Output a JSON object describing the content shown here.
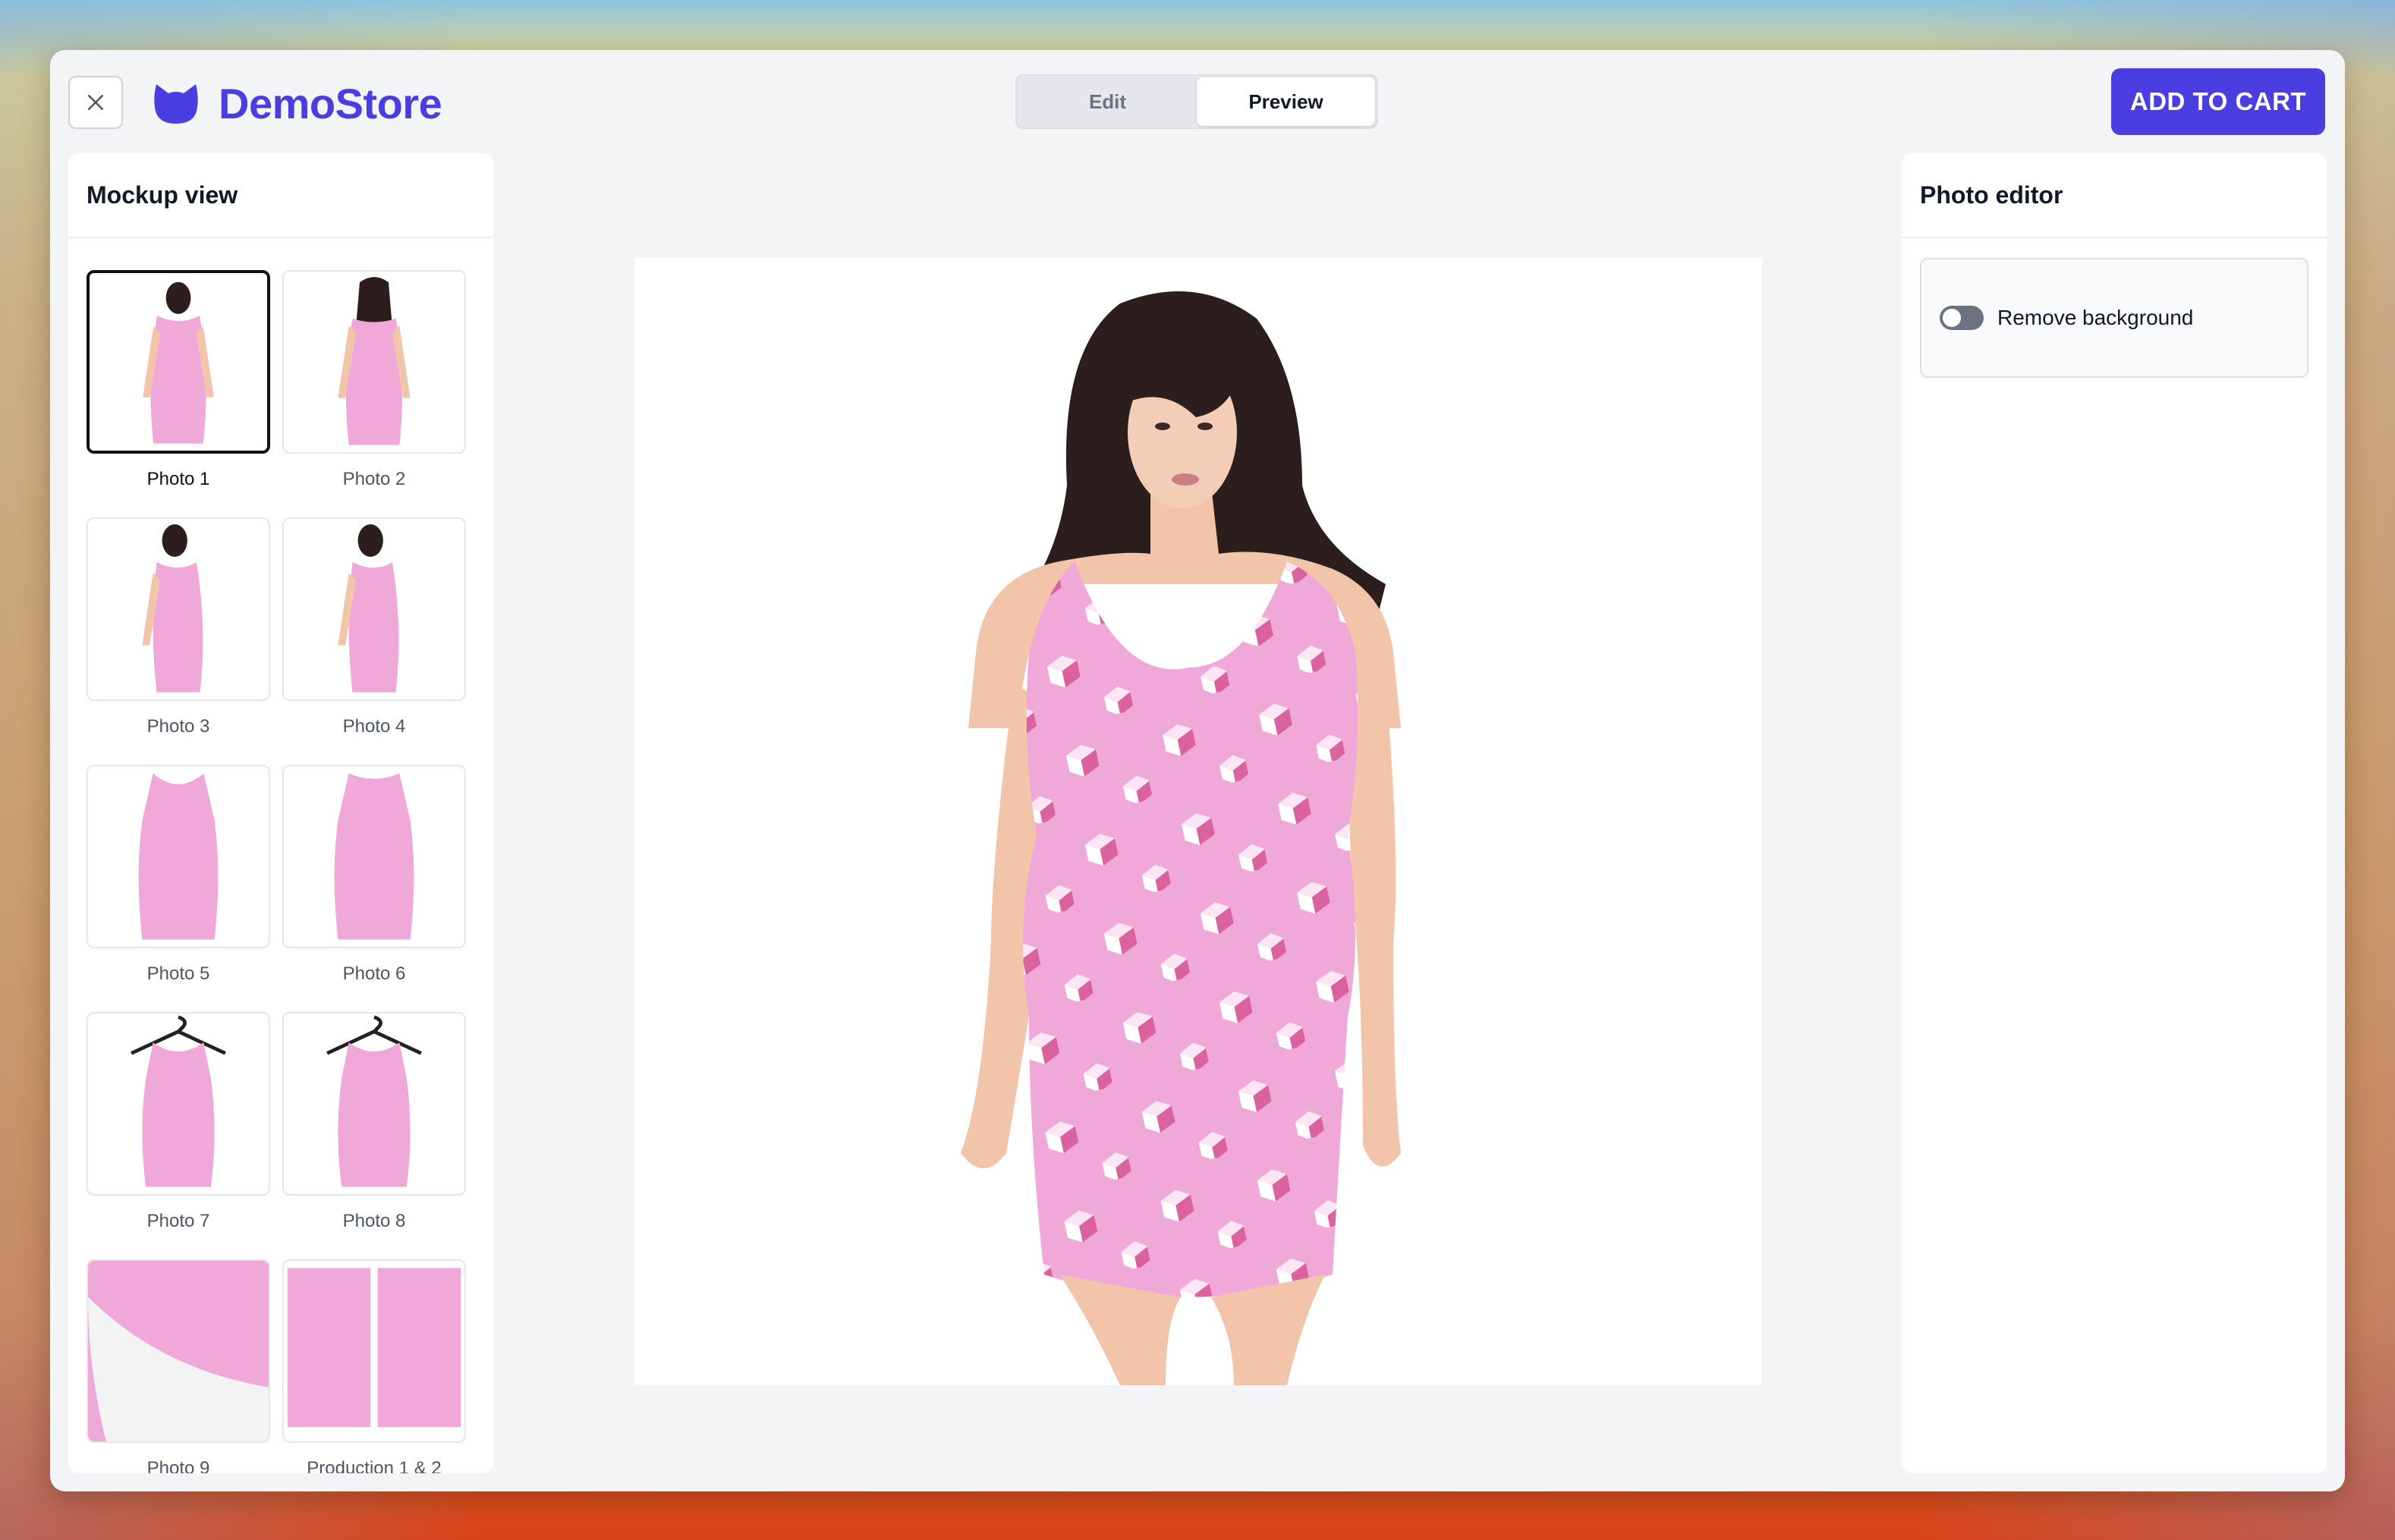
{
  "app": {
    "brand": "DemoStore",
    "brand_color": "#4a3ee0"
  },
  "header": {
    "close_icon": "close-icon",
    "tabs": [
      {
        "label": "Edit",
        "active": false
      },
      {
        "label": "Preview",
        "active": true
      }
    ],
    "add_to_cart_label": "ADD TO CART"
  },
  "left_panel": {
    "title": "Mockup view",
    "thumbnails": [
      {
        "label": "Photo 1",
        "selected": true,
        "kind": "model-front"
      },
      {
        "label": "Photo 2",
        "selected": false,
        "kind": "model-back"
      },
      {
        "label": "Photo 3",
        "selected": false,
        "kind": "model-side"
      },
      {
        "label": "Photo 4",
        "selected": false,
        "kind": "model-side"
      },
      {
        "label": "Photo 5",
        "selected": false,
        "kind": "dress-front"
      },
      {
        "label": "Photo 6",
        "selected": false,
        "kind": "dress-back"
      },
      {
        "label": "Photo 7",
        "selected": false,
        "kind": "dress-hanger"
      },
      {
        "label": "Photo 8",
        "selected": false,
        "kind": "dress-hanger"
      },
      {
        "label": "Photo 9",
        "selected": false,
        "kind": "detail"
      },
      {
        "label": "Production 1 & 2",
        "selected": false,
        "kind": "production"
      }
    ]
  },
  "preview": {
    "image": "model-in-pink-dress"
  },
  "right_panel": {
    "title": "Photo editor",
    "remove_background_label": "Remove background",
    "remove_background_enabled": false
  }
}
